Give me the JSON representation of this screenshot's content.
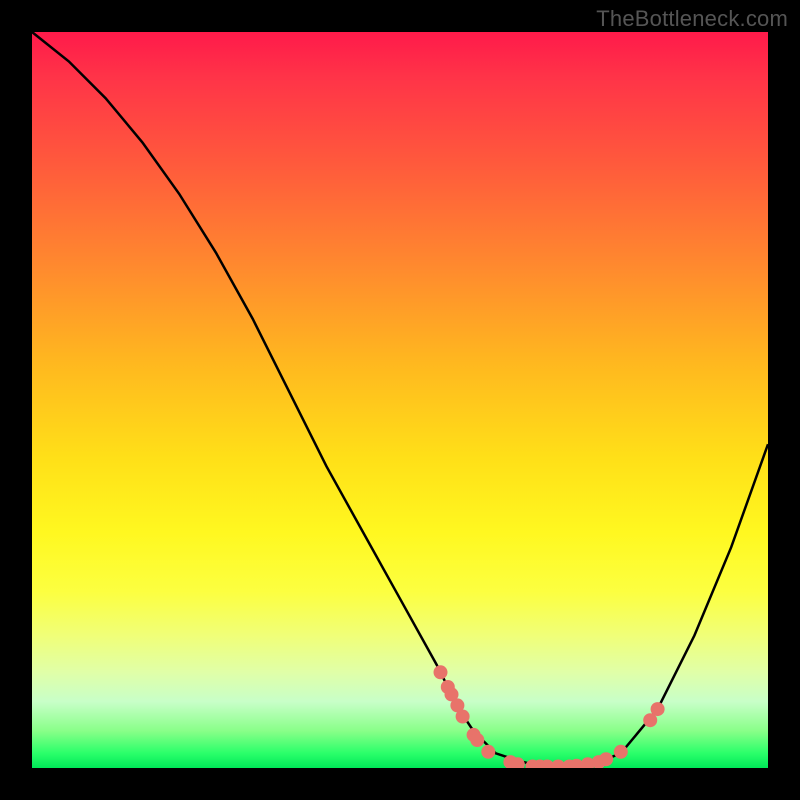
{
  "watermark": "TheBottleneck.com",
  "chart_data": {
    "type": "line",
    "title": "",
    "xlabel": "",
    "ylabel": "",
    "xlim": [
      0,
      100
    ],
    "ylim": [
      0,
      100
    ],
    "series": [
      {
        "name": "curve",
        "x": [
          0,
          5,
          10,
          15,
          20,
          25,
          30,
          35,
          40,
          45,
          50,
          55,
          58,
          60,
          63,
          66,
          70,
          75,
          80,
          85,
          90,
          95,
          100
        ],
        "y": [
          100,
          96,
          91,
          85,
          78,
          70,
          61,
          51,
          41,
          32,
          23,
          14,
          8,
          5,
          2,
          1,
          0,
          0,
          2,
          8,
          18,
          30,
          44
        ]
      }
    ],
    "markers": [
      {
        "x": 55.5,
        "y": 13
      },
      {
        "x": 56.5,
        "y": 11
      },
      {
        "x": 57.0,
        "y": 10
      },
      {
        "x": 57.8,
        "y": 8.5
      },
      {
        "x": 58.5,
        "y": 7
      },
      {
        "x": 60.0,
        "y": 4.5
      },
      {
        "x": 60.5,
        "y": 3.8
      },
      {
        "x": 62.0,
        "y": 2.2
      },
      {
        "x": 65.0,
        "y": 0.8
      },
      {
        "x": 66.0,
        "y": 0.5
      },
      {
        "x": 68.0,
        "y": 0.2
      },
      {
        "x": 69.0,
        "y": 0.2
      },
      {
        "x": 70.0,
        "y": 0.2
      },
      {
        "x": 71.5,
        "y": 0.2
      },
      {
        "x": 73.0,
        "y": 0.2
      },
      {
        "x": 74.0,
        "y": 0.3
      },
      {
        "x": 75.5,
        "y": 0.5
      },
      {
        "x": 77.0,
        "y": 0.8
      },
      {
        "x": 78.0,
        "y": 1.2
      },
      {
        "x": 80.0,
        "y": 2.2
      },
      {
        "x": 84.0,
        "y": 6.5
      },
      {
        "x": 85.0,
        "y": 8
      }
    ],
    "marker_color": "#e8736a",
    "curve_color": "#000000",
    "gradient": [
      "#ff1a4a",
      "#ffe018",
      "#00e858"
    ]
  }
}
